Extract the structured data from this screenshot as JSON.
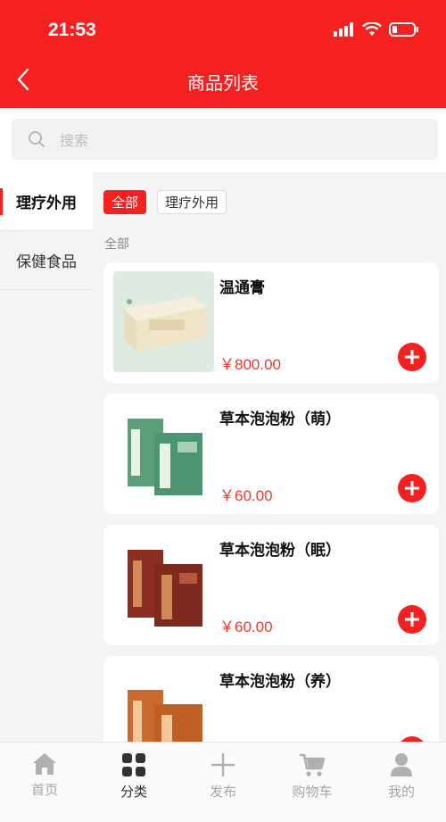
{
  "status_bar": {
    "time": "21:53"
  },
  "header": {
    "title": "商品列表"
  },
  "search": {
    "placeholder": "搜索"
  },
  "sidebar": {
    "items": [
      {
        "label": "理疗外用",
        "active": true
      },
      {
        "label": "保健食品",
        "active": false
      }
    ]
  },
  "filters": {
    "chips": [
      {
        "label": "全部",
        "active": true
      },
      {
        "label": "理疗外用",
        "active": false
      }
    ],
    "section_label": "全部"
  },
  "products": [
    {
      "name": "温通膏",
      "price": "￥800.00"
    },
    {
      "name": "草本泡泡粉（萌）",
      "price": "￥60.00"
    },
    {
      "name": "草本泡泡粉（眠）",
      "price": "￥60.00"
    },
    {
      "name": "草本泡泡粉（养）",
      "price": ""
    }
  ],
  "tabbar": {
    "items": [
      {
        "label": "首页",
        "icon": "home-icon",
        "active": false
      },
      {
        "label": "分类",
        "icon": "category-icon",
        "active": true
      },
      {
        "label": "发布",
        "icon": "plus-icon",
        "active": false
      },
      {
        "label": "购物车",
        "icon": "cart-icon",
        "active": false
      },
      {
        "label": "我的",
        "icon": "user-icon",
        "active": false
      }
    ]
  },
  "colors": {
    "brand_red": "#f52020",
    "price_red": "#f0392b"
  }
}
